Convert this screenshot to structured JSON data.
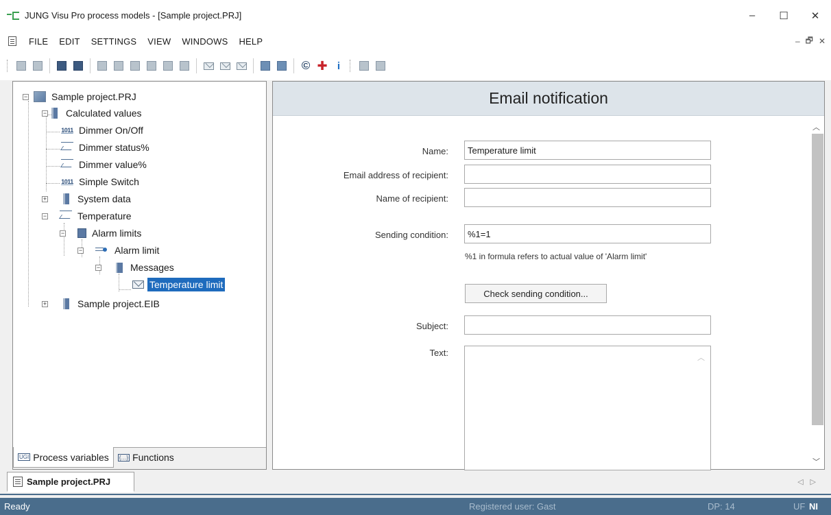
{
  "window": {
    "title": "JUNG Visu Pro process models - [Sample project.PRJ]",
    "minimize": "–",
    "maximize": "☐",
    "close": "✕"
  },
  "menu": {
    "items": [
      "FILE",
      "EDIT",
      "SETTINGS",
      "VIEW",
      "WINDOWS",
      "HELP"
    ],
    "mdi_min": "–",
    "mdi_restore": "🗗",
    "mdi_close": "✕"
  },
  "tree": {
    "root": "Sample project.PRJ",
    "calc_values": "Calculated values",
    "dimmer_onoff": "Dimmer On/Off",
    "dimmer_status": "Dimmer status%",
    "dimmer_value": "Dimmer value%",
    "simple_switch": "Simple Switch",
    "system_data": "System data",
    "temperature": "Temperature",
    "alarm_limits": "Alarm limits",
    "alarm_limit": "Alarm limit",
    "messages": "Messages",
    "temperature_limit": "Temperature limit",
    "eib": "Sample project.EIB"
  },
  "left_tabs": {
    "process_variables": "Process variables",
    "functions": "Functions"
  },
  "form": {
    "header": "Email notification",
    "name_label": "Name:",
    "name_value": "Temperature limit",
    "email_label": "Email address of recipient:",
    "email_value": "",
    "recipient_label": "Name of recipient:",
    "recipient_value": "",
    "condition_label": "Sending condition:",
    "condition_value": "%1=1",
    "hint": "%1 in formula refers to actual value of 'Alarm limit'",
    "check_button": "Check sending condition...",
    "subject_label": "Subject:",
    "subject_value": "",
    "text_label": "Text:"
  },
  "doc_tab": {
    "label": "Sample project.PRJ"
  },
  "status": {
    "state": "Ready",
    "user": "Registered user: Gast",
    "dp": "DP: 14",
    "flags_uf": "UF",
    "flags_nl": "NI"
  }
}
